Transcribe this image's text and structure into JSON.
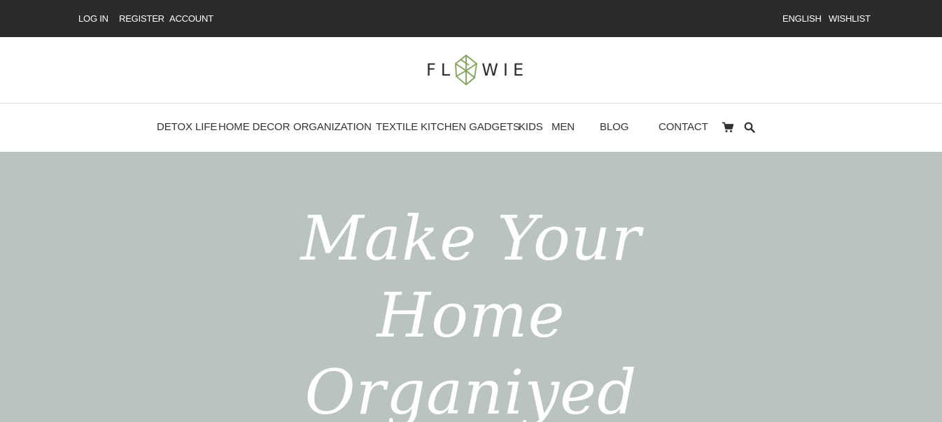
{
  "topbar": {
    "links_left": [
      "LOG IN",
      "REGISTER",
      "ACCOUNT"
    ],
    "links_right": [
      "ENGLISH",
      "WISHLIST"
    ]
  },
  "logo": {
    "left": "FL",
    "right": "WIE"
  },
  "nav": {
    "items": [
      "DETOX LIFE",
      "HOME DECOR",
      "ORGANIZATION",
      "TEXTILE",
      "KITCHEN GADGETS",
      "KIDS",
      "MEN",
      "BLOG",
      "CONTACT"
    ],
    "icons": [
      "cart-icon",
      "search-icon"
    ]
  },
  "hero": {
    "lines": [
      "Make Your",
      "Home",
      "Organiyed"
    ],
    "background": "#b8c3c2"
  },
  "colors": {
    "topbar": "#2b2b2b",
    "logo_accent": "#7fa35a",
    "text": "#333333"
  }
}
